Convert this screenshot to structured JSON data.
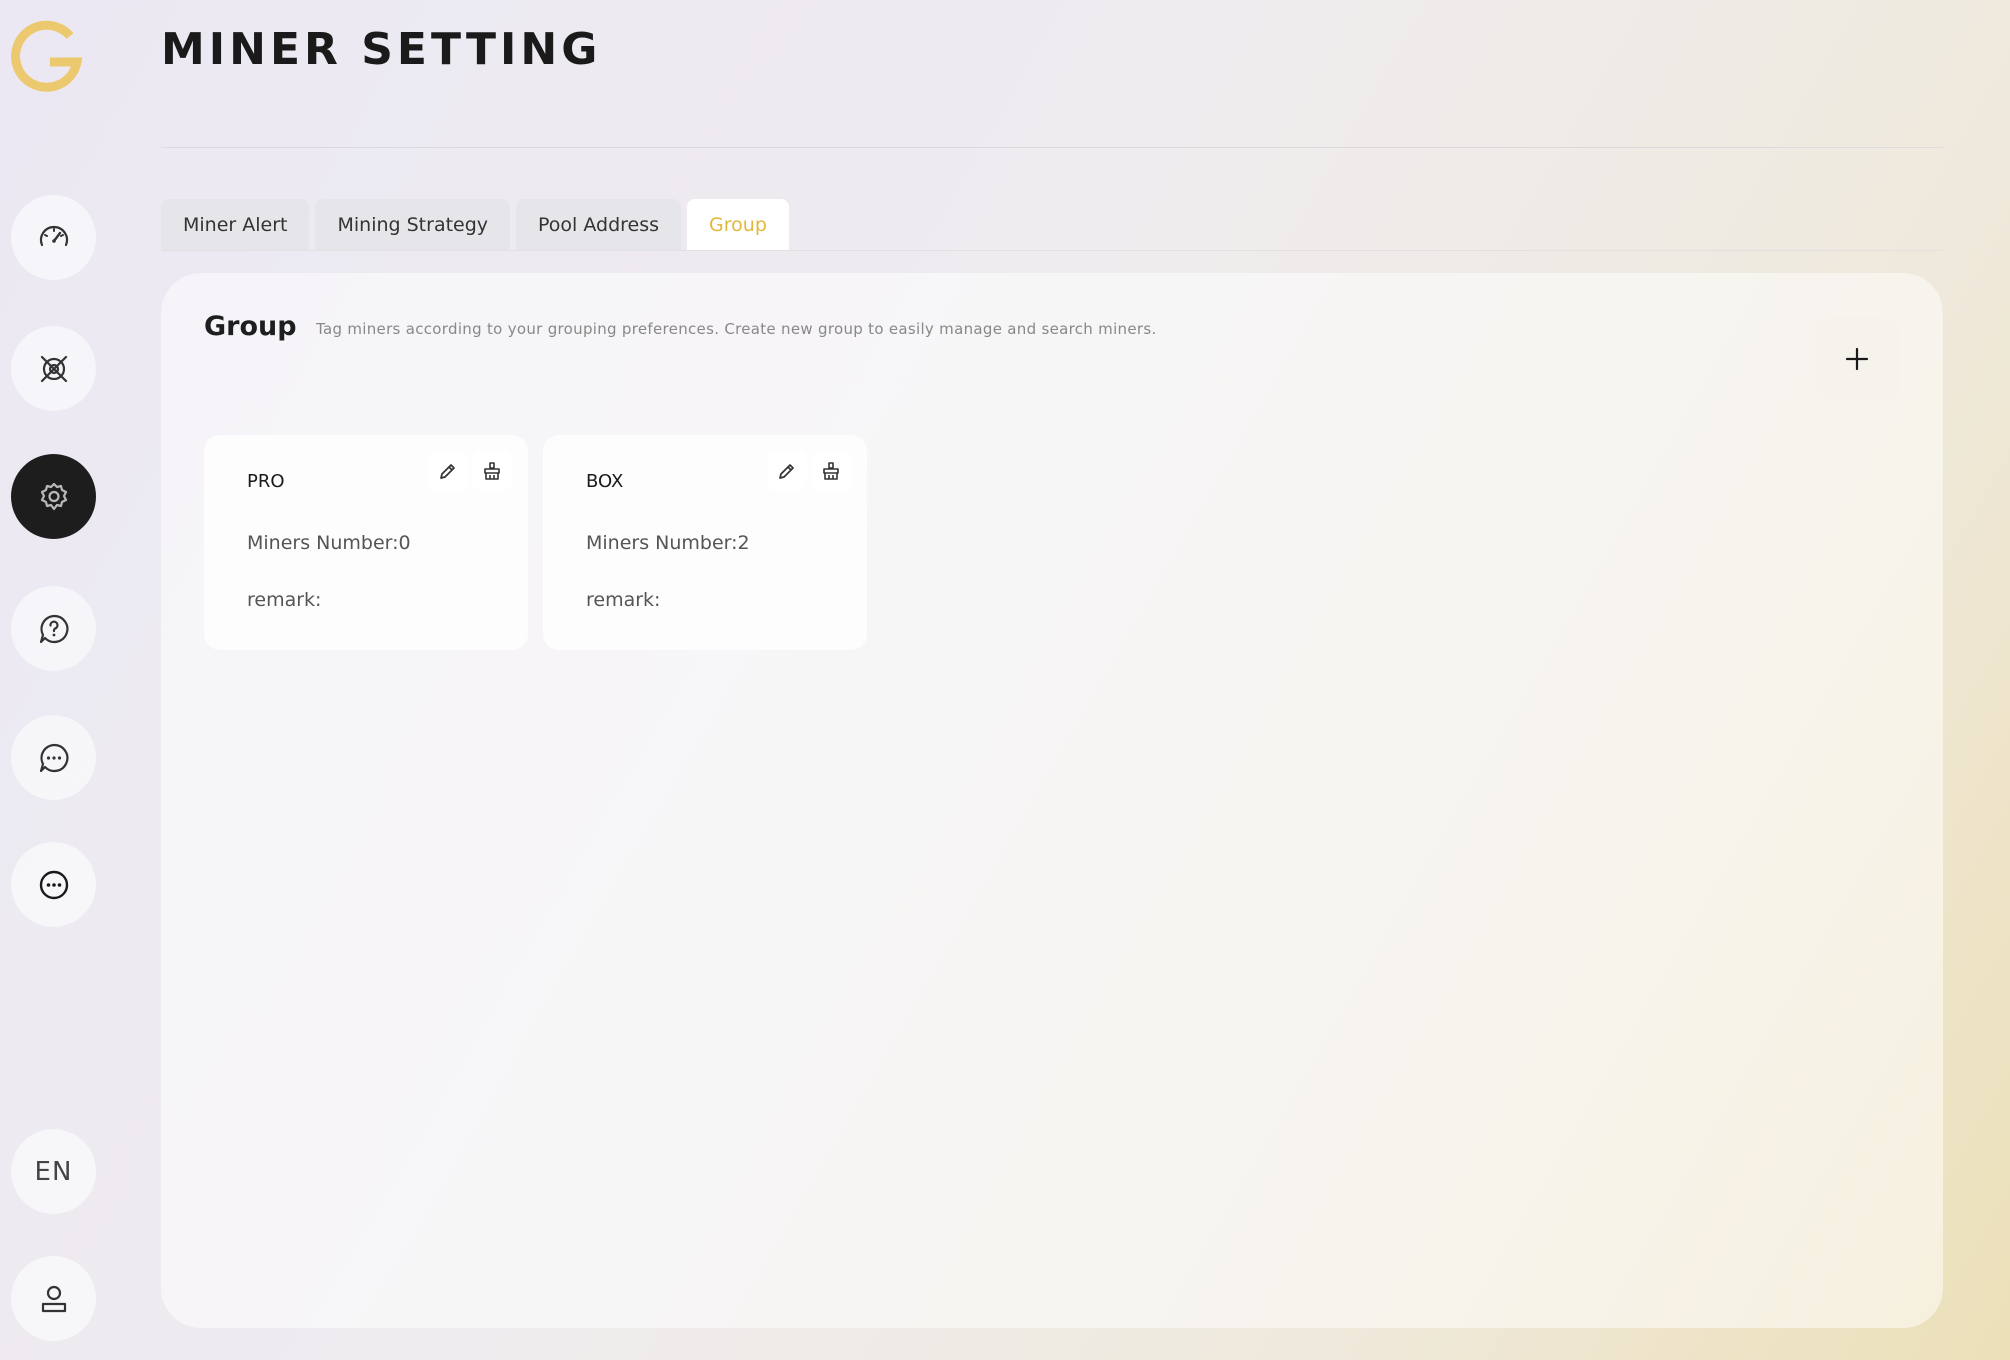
{
  "header": {
    "title": "MINER SETTING"
  },
  "sidebar": {
    "items": [
      {
        "icon": "dashboard-icon"
      },
      {
        "icon": "miners-icon"
      },
      {
        "icon": "settings-icon",
        "active": true
      },
      {
        "icon": "help-icon"
      },
      {
        "icon": "chat-icon"
      },
      {
        "icon": "more-icon"
      }
    ],
    "language": "EN",
    "user_icon": "user-icon"
  },
  "tabs": [
    {
      "label": "Miner Alert",
      "active": false
    },
    {
      "label": "Mining Strategy",
      "active": false
    },
    {
      "label": "Pool Address",
      "active": false
    },
    {
      "label": "Group",
      "active": true
    }
  ],
  "group": {
    "title": "Group",
    "description": "Tag miners according to your grouping preferences. Create new group to easily manage and search miners.",
    "add_icon": "plus-icon",
    "cards": [
      {
        "name": "PRO",
        "miners_label": "Miners Number:0",
        "remark_label": "remark:"
      },
      {
        "name": "BOX",
        "miners_label": "Miners Number:2",
        "remark_label": "remark:"
      }
    ]
  },
  "colors": {
    "accent": "#e0b83c",
    "logo": "#ecc96e",
    "active_nav": "#1d1d1d"
  }
}
